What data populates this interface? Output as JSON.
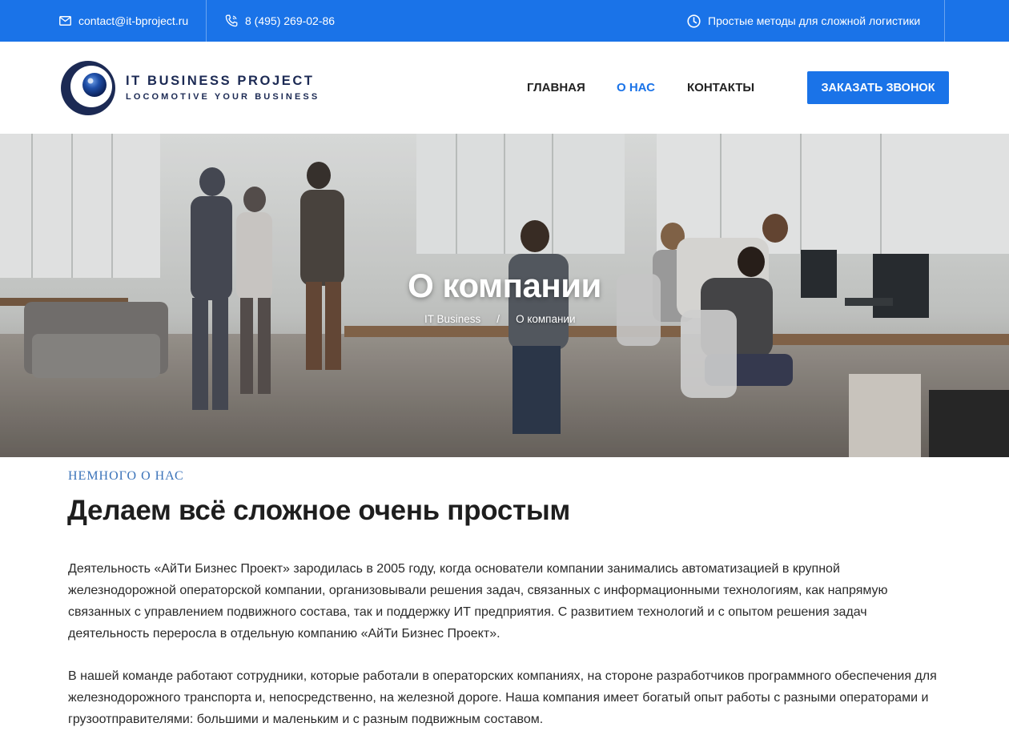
{
  "topbar": {
    "email": "contact@it-bproject.ru",
    "phone": "8 (495) 269-02-86",
    "slogan": "Простые методы для сложной логистики",
    "icons": [
      "mail-icon",
      "phone-icon",
      "clock-icon"
    ]
  },
  "header": {
    "logo_title": "IT BUSINESS PROJECT",
    "logo_subtitle": "LOCOMOTIVE YOUR BUSINESS",
    "nav": [
      {
        "label": "Главная",
        "active": false
      },
      {
        "label": "О нас",
        "active": true
      },
      {
        "label": "Контакты",
        "active": false
      }
    ],
    "cta_label": "Заказать звонок"
  },
  "hero": {
    "title": "О компании",
    "breadcrumb": [
      "IT Business",
      "О компании"
    ],
    "breadcrumb_separator": "/"
  },
  "content": {
    "eyebrow": "Немного о нас",
    "heading": "Делаем всё сложное очень простым",
    "paragraphs": [
      "Деятельность «АйТи Бизнес Проект» зародилась в 2005 году, когда основатели компании занимались автоматизацией в крупной железнодорожной операторской компании, организовывали решения задач, связанных с информационными технологиям, как напрямую связанных с управлением подвижного состава, так и поддержку ИТ предприятия. С развитием технологий и с опытом решения задач деятельность переросла в отдельную компанию «АйТи Бизнес Проект».",
      "В нашей команде работают сотрудники, которые работали в операторских компаниях, на стороне разработчиков программного обеспечения для железнодорожного транспорта и, непосредственно, на железной дороге. Наша компания имеет богатый опыт работы с разными операторами и грузоотправителями: большими и маленьким и с разным подвижным составом."
    ]
  },
  "colors": {
    "accent": "#1a73e8",
    "brand_navy": "#1c2a54",
    "eyebrow": "#3b73b9"
  }
}
